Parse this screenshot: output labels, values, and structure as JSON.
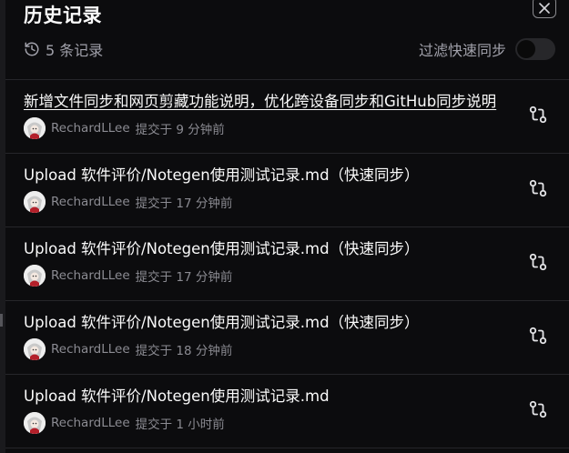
{
  "header": {
    "title": "历史记录",
    "close_icon": "close-icon",
    "record_count": "5 条记录",
    "history_icon": "history-icon",
    "filter_label": "过滤快速同步",
    "filter_enabled": false
  },
  "colors": {
    "background": "#0c0c0e",
    "text": "#fafafa",
    "muted": "#8b8b92",
    "divider": "#26262a",
    "toggle_off": "#27272a"
  },
  "commits": [
    {
      "message": "新增文件同步和网页剪藏功能说明，优化跨设备同步和GitHub同步说明",
      "author": "RechardLLee",
      "time": "提交于 9 分钟前",
      "icon": "git-compare-icon"
    },
    {
      "message": "Upload 软件评价/Notegen使用测试记录.md（快速同步）",
      "author": "RechardLLee",
      "time": "提交于 17 分钟前",
      "icon": "git-compare-icon"
    },
    {
      "message": "Upload 软件评价/Notegen使用测试记录.md（快速同步）",
      "author": "RechardLLee",
      "time": "提交于 17 分钟前",
      "icon": "git-compare-icon"
    },
    {
      "message": "Upload 软件评价/Notegen使用测试记录.md（快速同步）",
      "author": "RechardLLee",
      "time": "提交于 18 分钟前",
      "icon": "git-compare-icon"
    },
    {
      "message": "Upload 软件评价/Notegen使用测试记录.md",
      "author": "RechardLLee",
      "time": "提交于 1 小时前",
      "icon": "git-compare-icon"
    }
  ]
}
